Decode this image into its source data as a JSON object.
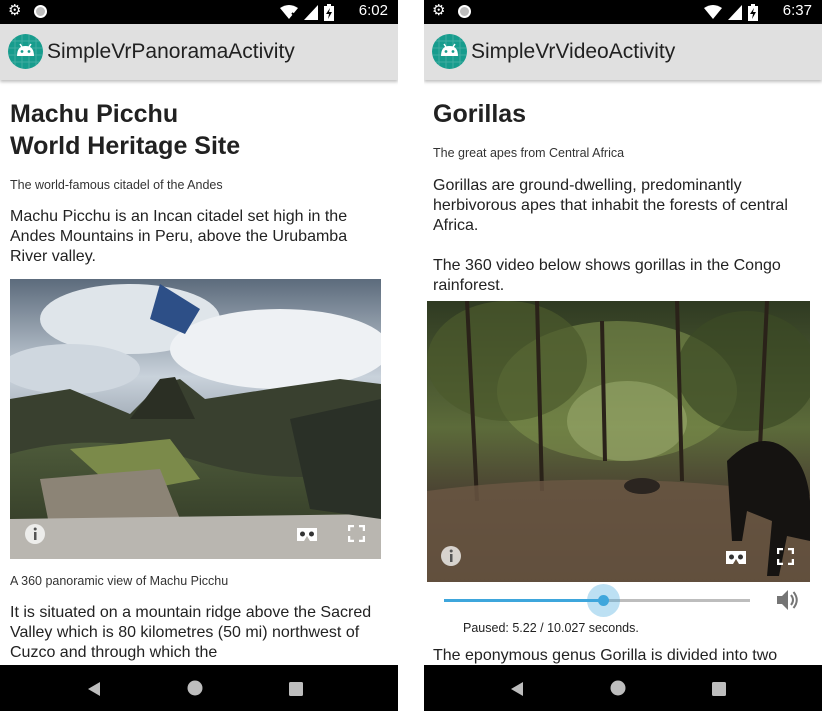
{
  "colors": {
    "status_bar": "#000000",
    "app_bar": "#e0e0e0",
    "android_logo_bg": "#179c8d",
    "accent": "#3ea6dc",
    "nav_bar": "#000000"
  },
  "left": {
    "status": {
      "time": "6:02",
      "icons": [
        "gear-icon",
        "circle-notification-icon",
        "wifi-off-icon",
        "signal-icon",
        "battery-charging-icon"
      ]
    },
    "app_bar": {
      "title": "SimpleVrPanoramaActivity",
      "icon": "android-logo-icon"
    },
    "heading_line1": "Machu Picchu",
    "heading_line2": "World Heritage Site",
    "subtitle": "The world-famous citadel of the Andes",
    "intro": "Machu Picchu is an Incan citadel set high in the Andes Mountains in Peru, above the Urubamba River valley.",
    "panorama": {
      "icons": [
        "info-icon",
        "cardboard-icon",
        "fullscreen-icon"
      ]
    },
    "caption": "A 360 panoramic view of Machu Picchu",
    "body": "It is situated on a mountain ridge above the Sacred Valley which is 80 kilometres (50 mi) northwest of Cuzco and through which the"
  },
  "right": {
    "status": {
      "time": "6:37",
      "icons": [
        "gear-icon",
        "circle-notification-icon",
        "wifi-icon",
        "signal-icon",
        "battery-charging-icon"
      ]
    },
    "app_bar": {
      "title": "SimpleVrVideoActivity",
      "icon": "android-logo-icon"
    },
    "heading": "Gorillas",
    "subtitle": "The great apes from Central Africa",
    "intro": "Gorillas are ground-dwelling, predominantly herbivorous apes that inhabit the forests of central Africa.\n\nThe 360 video below shows gorillas in the Congo rainforest.",
    "video": {
      "icons": [
        "info-icon",
        "cardboard-icon",
        "fullscreen-icon"
      ]
    },
    "seek": {
      "position": 5.22,
      "duration": 10.027
    },
    "volume_icon": "volume-icon",
    "status_text": "Paused: 5.22 / 10.027 seconds.",
    "body": "The eponymous genus Gorilla is divided into two"
  },
  "nav": {
    "icons": [
      "back-icon",
      "home-icon",
      "recents-icon"
    ]
  }
}
